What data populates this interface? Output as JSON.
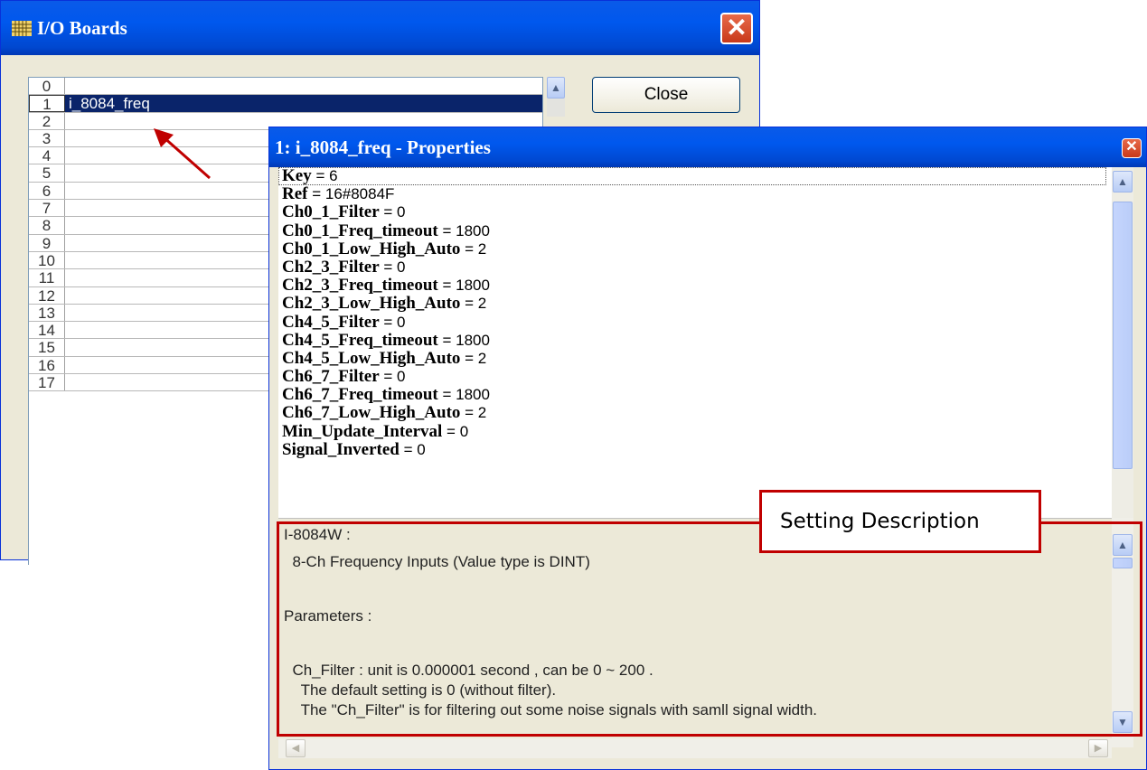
{
  "io_window": {
    "title": "I/O Boards",
    "close_label": "Close",
    "rows": [
      {
        "index": "0",
        "name": ""
      },
      {
        "index": "1",
        "name": "i_8084_freq"
      },
      {
        "index": "2",
        "name": ""
      },
      {
        "index": "3",
        "name": ""
      },
      {
        "index": "4",
        "name": ""
      },
      {
        "index": "5",
        "name": ""
      },
      {
        "index": "6",
        "name": ""
      },
      {
        "index": "7",
        "name": ""
      },
      {
        "index": "8",
        "name": ""
      },
      {
        "index": "9",
        "name": ""
      },
      {
        "index": "10",
        "name": ""
      },
      {
        "index": "11",
        "name": ""
      },
      {
        "index": "12",
        "name": ""
      },
      {
        "index": "13",
        "name": ""
      },
      {
        "index": "14",
        "name": ""
      },
      {
        "index": "15",
        "name": ""
      },
      {
        "index": "16",
        "name": ""
      },
      {
        "index": "17",
        "name": ""
      }
    ],
    "selected_index": "1"
  },
  "props_window": {
    "title": "1: i_8084_freq - Properties",
    "properties": [
      {
        "key": "Key",
        "value": "6"
      },
      {
        "key": "Ref",
        "value": "16#8084F"
      },
      {
        "key": "Ch0_1_Filter",
        "value": "0"
      },
      {
        "key": "Ch0_1_Freq_timeout",
        "value": "1800"
      },
      {
        "key": "Ch0_1_Low_High_Auto",
        "value": "2"
      },
      {
        "key": "Ch2_3_Filter",
        "value": "0"
      },
      {
        "key": "Ch2_3_Freq_timeout",
        "value": "1800"
      },
      {
        "key": "Ch2_3_Low_High_Auto",
        "value": "2"
      },
      {
        "key": "Ch4_5_Filter",
        "value": "0"
      },
      {
        "key": "Ch4_5_Freq_timeout",
        "value": "1800"
      },
      {
        "key": "Ch4_5_Low_High_Auto",
        "value": "2"
      },
      {
        "key": "Ch6_7_Filter",
        "value": "0"
      },
      {
        "key": "Ch6_7_Freq_timeout",
        "value": "1800"
      },
      {
        "key": "Ch6_7_Low_High_Auto",
        "value": "2"
      },
      {
        "key": "Min_Update_Interval",
        "value": "0"
      },
      {
        "key": "Signal_Inverted",
        "value": "0"
      }
    ],
    "description_lines": [
      "I-8084W :",
      "  8-Ch Frequency Inputs (Value type is DINT)",
      "",
      "Parameters :",
      "",
      "  Ch_Filter : unit is 0.000001 second , can be 0 ~ 200 .",
      "    The default setting is 0 (without filter).",
      "    The \"Ch_Filter\" is for filtering out some noise signals with samll signal width."
    ]
  },
  "annotation": {
    "label": "Setting Description",
    "color": "#c00000"
  },
  "icons": {
    "window_icon": "grid-icon",
    "close": "close-icon",
    "scroll_up": "arrow-up-icon",
    "scroll_down": "arrow-down-icon",
    "scroll_left": "arrow-left-icon",
    "scroll_right": "arrow-right-icon"
  }
}
